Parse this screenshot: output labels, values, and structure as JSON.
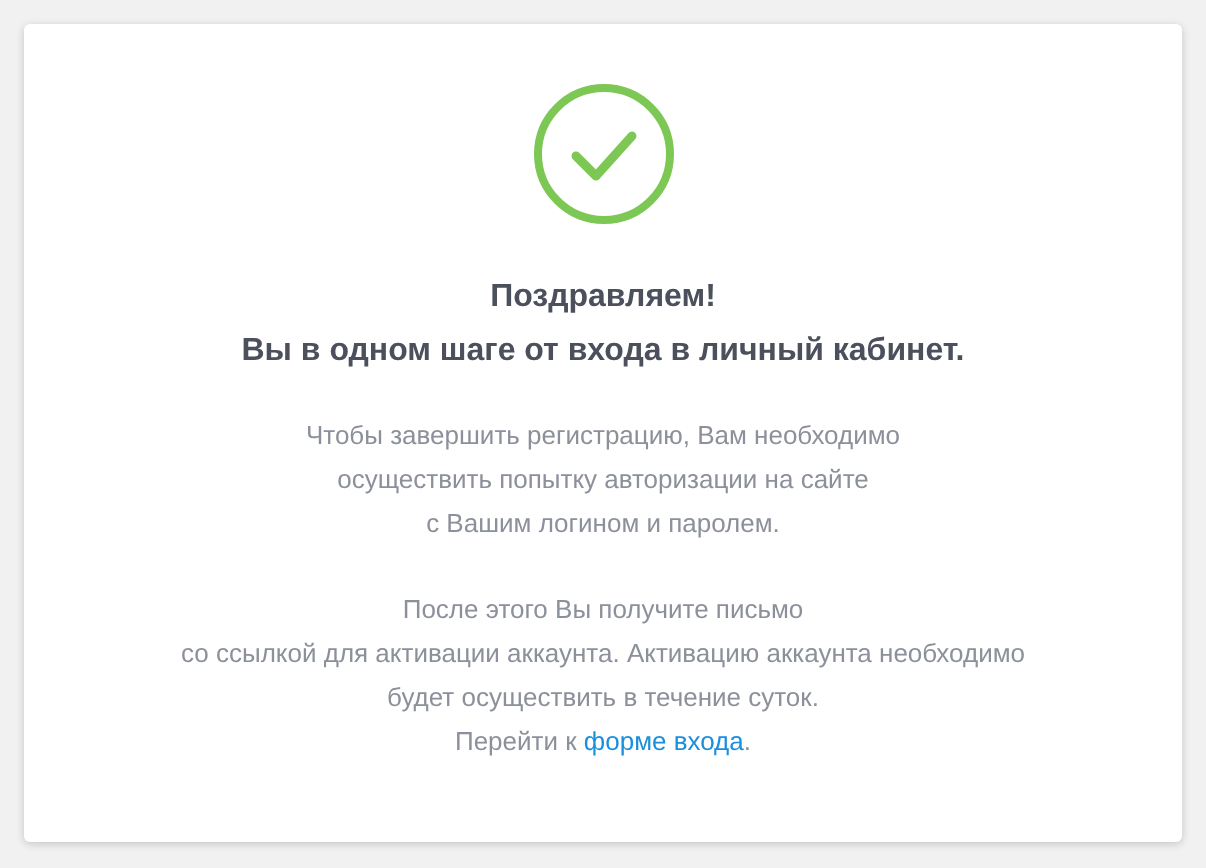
{
  "card": {
    "kind": "success",
    "heading": [
      "Поздравляем!",
      "Вы в одном шаге от входа в личный кабинет."
    ],
    "paragraphs": [
      {
        "lines": [
          "Чтобы завершить регистрацию, Вам необходимо",
          "осуществить попытку авторизации на сайте",
          "с Вашим логином и паролем."
        ]
      },
      {
        "lines": [
          "После этого Вы получите письмо",
          "со ссылкой для активации аккаунта. Активацию аккаунта необходимо",
          "будет осуществить в течение суток."
        ],
        "link_line": {
          "before": "Перейти к ",
          "link": "форме входа",
          "after": "."
        }
      }
    ]
  }
}
